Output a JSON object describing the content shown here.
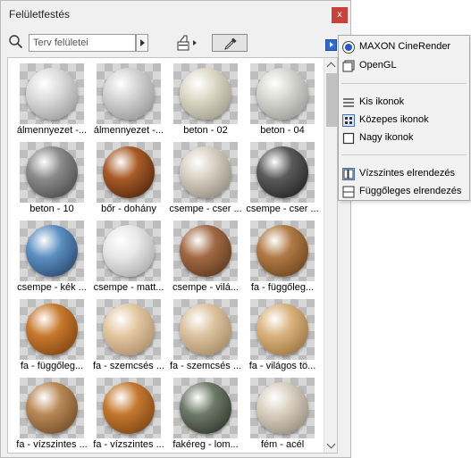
{
  "window": {
    "title": "Felületfestés",
    "close_glyph": "x"
  },
  "toolbar": {
    "search_placeholder": "Terv felületei",
    "search_icon": "search-icon",
    "brush_icon": "paint-brush-icon",
    "eyedropper_icon": "eyedropper-icon"
  },
  "materials": [
    {
      "label": "álmennyezet -...",
      "color": "#dcdcdc",
      "shade": "#8a8a8a"
    },
    {
      "label": "álmennyezet -...",
      "color": "#d4d4d4",
      "shade": "#868686"
    },
    {
      "label": "beton - 02",
      "color": "#ddd9c6",
      "shade": "#8e8a78"
    },
    {
      "label": "beton - 04",
      "color": "#d7d7d2",
      "shade": "#8a8a86"
    },
    {
      "label": "beton - 10",
      "color": "#8a8a8a",
      "shade": "#3a3a3a"
    },
    {
      "label": "bőr - dohány",
      "color": "#a85a26",
      "shade": "#3a1a08"
    },
    {
      "label": "csempe - cser ...",
      "color": "#d8d0c2",
      "shade": "#7d766c"
    },
    {
      "label": "csempe - cser ...",
      "color": "#5a5a5a",
      "shade": "#151515"
    },
    {
      "label": "csempe - kék ...",
      "color": "#5b8fc2",
      "shade": "#1c3555"
    },
    {
      "label": "csempe - matt...",
      "color": "#e8e8e8",
      "shade": "#9a9a9a"
    },
    {
      "label": "csempe - vilá...",
      "color": "#a26a44",
      "shade": "#4a2812"
    },
    {
      "label": "fa - függőleg...",
      "color": "#b07a45",
      "shade": "#5a3514"
    },
    {
      "label": "fa - függőleg...",
      "color": "#c8792c",
      "shade": "#6a350c"
    },
    {
      "label": "fa - szemcsés ...",
      "color": "#e3c7a2",
      "shade": "#9c7e5a"
    },
    {
      "label": "fa - szemcsés ...",
      "color": "#dcc29e",
      "shade": "#957a56"
    },
    {
      "label": "fa - világos tö...",
      "color": "#d9b27c",
      "shade": "#8a6232"
    },
    {
      "label": "fa - vízszintes ...",
      "color": "#b88755",
      "shade": "#5e3d1c"
    },
    {
      "label": "fa - vízszintes ...",
      "color": "#c4782e",
      "shade": "#6a350e"
    },
    {
      "label": "fakéreg - lom...",
      "color": "#6d7a68",
      "shade": "#1e241c"
    },
    {
      "label": "fém - acél",
      "color": "#d9cfc0",
      "shade": "#857a6a"
    }
  ],
  "menu": {
    "render_engines": [
      {
        "label": "MAXON CineRender",
        "icon": "radio-selected-icon"
      },
      {
        "label": "OpenGL",
        "icon": "opengl-window-icon"
      }
    ],
    "icon_sizes": [
      {
        "label": "Kis ikonok",
        "icon": "list-view-icon"
      },
      {
        "label": "Közepes ikonok",
        "icon": "grid-view-icon"
      },
      {
        "label": "Nagy ikonok",
        "icon": "large-icon-view-icon"
      }
    ],
    "layouts": [
      {
        "label": "Vízszintes elrendezés",
        "icon": "split-vertical-icon"
      },
      {
        "label": "Függőleges elrendezés",
        "icon": "split-horizontal-icon"
      }
    ]
  },
  "colors": {
    "accent": "#2d6bd0",
    "close": "#c8413b"
  }
}
